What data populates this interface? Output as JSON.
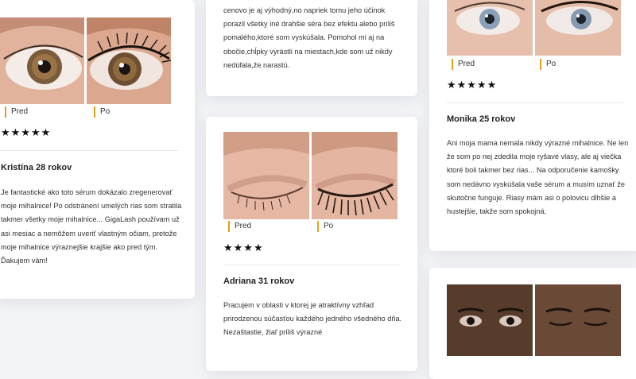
{
  "colors": {
    "accent": "#e3a21a",
    "background": "#f3f4f7",
    "card": "#ffffff"
  },
  "reviews": [
    {
      "before_label": "Pred",
      "after_label": "Po",
      "stars": "★★★★★",
      "name": "Kristína 28 rokov",
      "text": "Je fantastické ako toto sérum dokázalo zregenerovať moje mihalnice! Po odstránení umelých rias som stratila takmer všetky moje mihalnice... GigaLash používam už asi mesiac a nemôžem uveriť vlastným očiam, pretože moje mihalnice výraznejšie krajšie ako pred tým. Ďakujem vám!"
    },
    {
      "text": "cenovo je aj výhodný,no napriek tomu jeho účinok porazil všetky iné drahšie séra bez efektu alebo príliš pomalého,ktoré som vyskúšala. Pomohol mi aj na obočie,chĺpky vyrástli na miestach,kde som už nikdy nedúfala,že narastú."
    },
    {
      "before_label": "Pred",
      "after_label": "Po",
      "stars": "★★★★",
      "name": "Adriana 31 rokov",
      "text": "Pracujem v oblasti v ktorej je atraktívny vzhľad prirodzenou súčasťou každého jedného všedného dňa. Nezaštastie, žiaľ príliš výrazné"
    },
    {
      "before_label": "Pred",
      "after_label": "Po",
      "stars": "★★★★★",
      "name": "Monika 25 rokov",
      "text": "Ani moja mama nemala nikdy výrazné mihalnice. Ne len že som po nej zdedila moje ryšavé vlasy, ale aj viečka ktoré boli takmer bez rias... Na odporučenie kamošky som nedávno vyskúšala vaše sérum a musím uznať že skutočne funguje. Riasy mám asi o polovicu dlhšie a hustejšie, takže som spokojná."
    }
  ]
}
